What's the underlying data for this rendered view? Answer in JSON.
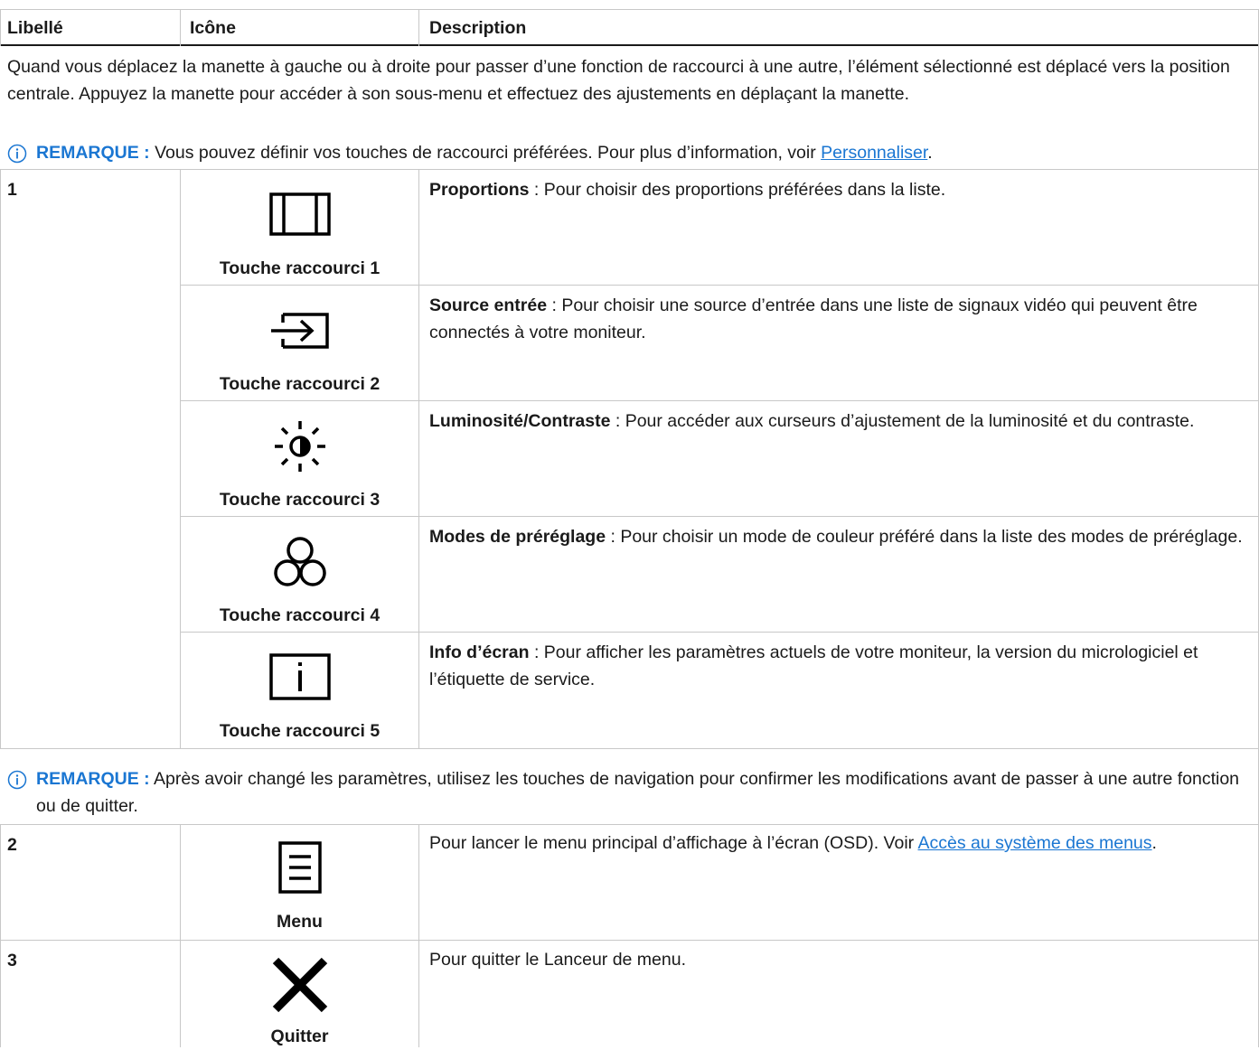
{
  "header": {
    "col1": "Libellé",
    "col2": "Icône",
    "col3": "Description"
  },
  "intro": "Quand vous déplacez la manette à gauche ou à droite pour passer d’une fonction de raccourci à une autre, l’élément sélectionné est déplacé vers la position centrale. Appuyez la manette pour accéder à son sous-menu et effectuez des ajustements en déplaçant la manette.",
  "note1": {
    "label": "REMARQUE :",
    "text": " Vous pouvez définir vos touches de raccourci préférées. Pour plus d’information, voir ",
    "link": "Personnaliser",
    "after": "."
  },
  "row1": {
    "number": "1",
    "items": [
      {
        "icon": "aspect-ratio-icon",
        "caption": "Touche raccourci 1",
        "title": "Proportions",
        "text": " : Pour choisir des proportions préférées dans la liste."
      },
      {
        "icon": "input-source-icon",
        "caption": "Touche raccourci 2",
        "title": "Source entrée",
        "text": " : Pour choisir une source d’entrée dans une liste de signaux vidéo qui peuvent être connectés à votre moniteur."
      },
      {
        "icon": "brightness-icon",
        "caption": "Touche raccourci 3",
        "title": "Luminosité/Contraste",
        "text": " : Pour accéder aux curseurs d’ajustement de la luminosité et du contraste."
      },
      {
        "icon": "preset-modes-icon",
        "caption": "Touche raccourci 4",
        "title": "Modes de préréglage",
        "text": " : Pour choisir un mode de couleur préféré dans la liste des modes de préréglage."
      },
      {
        "icon": "display-info-icon",
        "caption": "Touche raccourci 5",
        "title": "Info d’écran",
        "text": " : Pour afficher les paramètres actuels de votre moniteur, la version du micrologiciel et l’étiquette de service."
      }
    ]
  },
  "note2": {
    "label": "REMARQUE :",
    "text": " Après avoir changé les paramètres, utilisez les touches de navigation pour confirmer les modifications avant de passer à une autre fonction ou de quitter."
  },
  "row2": {
    "number": "2",
    "icon": "menu-icon",
    "caption": "Menu",
    "text": "Pour lancer le menu principal d’affichage à l’écran (OSD). Voir ",
    "link": "Accès au système des menus",
    "after": "."
  },
  "row3": {
    "number": "3",
    "icon": "close-icon",
    "caption": "Quitter",
    "text": "Pour quitter le Lanceur de menu."
  },
  "colors": {
    "link": "#1a76d2",
    "border": "#c8c8c8",
    "text": "#1a1a1a"
  }
}
